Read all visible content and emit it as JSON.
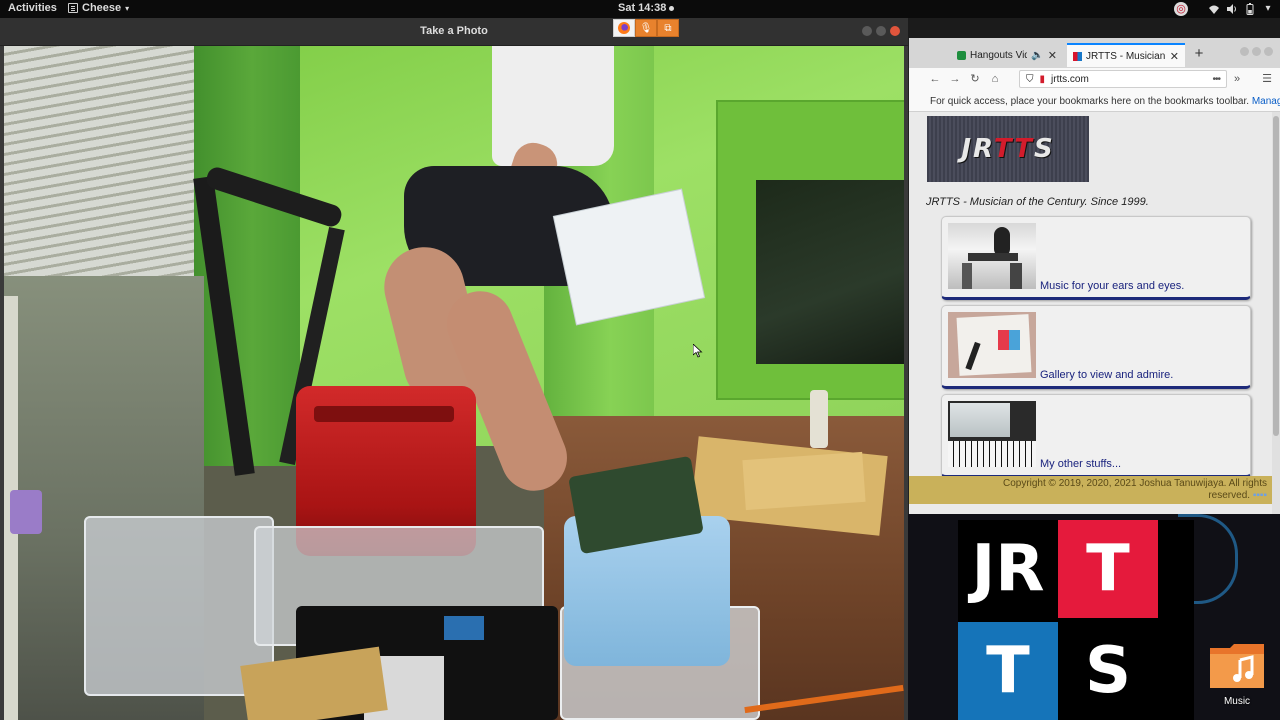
{
  "topbar": {
    "activities": "Activities",
    "app_name": "Cheese",
    "clock": "Sat 14:38"
  },
  "cheese": {
    "title": "Take a Photo"
  },
  "firefox": {
    "tabs": [
      {
        "label": "Hangouts Vide",
        "active": false
      },
      {
        "label": "JRTTS - Musician",
        "active": true
      }
    ],
    "url": "jrtts.com",
    "bookmarks_hint": "For quick access, place your bookmarks here on the bookmarks toolbar.",
    "bookmarks_manage": "Manage",
    "page": {
      "logo": "JRTTS",
      "tagline": "JRTTS - Musician of the Century. Since 1999.",
      "cards": [
        {
          "caption": "Music for your ears and eyes."
        },
        {
          "caption": "Gallery to view and admire."
        },
        {
          "caption": "My other stuffs..."
        }
      ],
      "copyright_line1": "Copyright © 2019, 2020, 2021 Joshua Tanuwijaya. All rights",
      "copyright_line2": "reserved."
    }
  },
  "desktop": {
    "big_logo_letters": [
      "JR",
      "T",
      "T",
      "S"
    ],
    "music_folder_label": "Music"
  },
  "colors": {
    "brand_red": "#e51a3c",
    "brand_blue": "#1574b9",
    "firefox_accent": "#0a84ff",
    "cheese_close": "#e1553c"
  }
}
